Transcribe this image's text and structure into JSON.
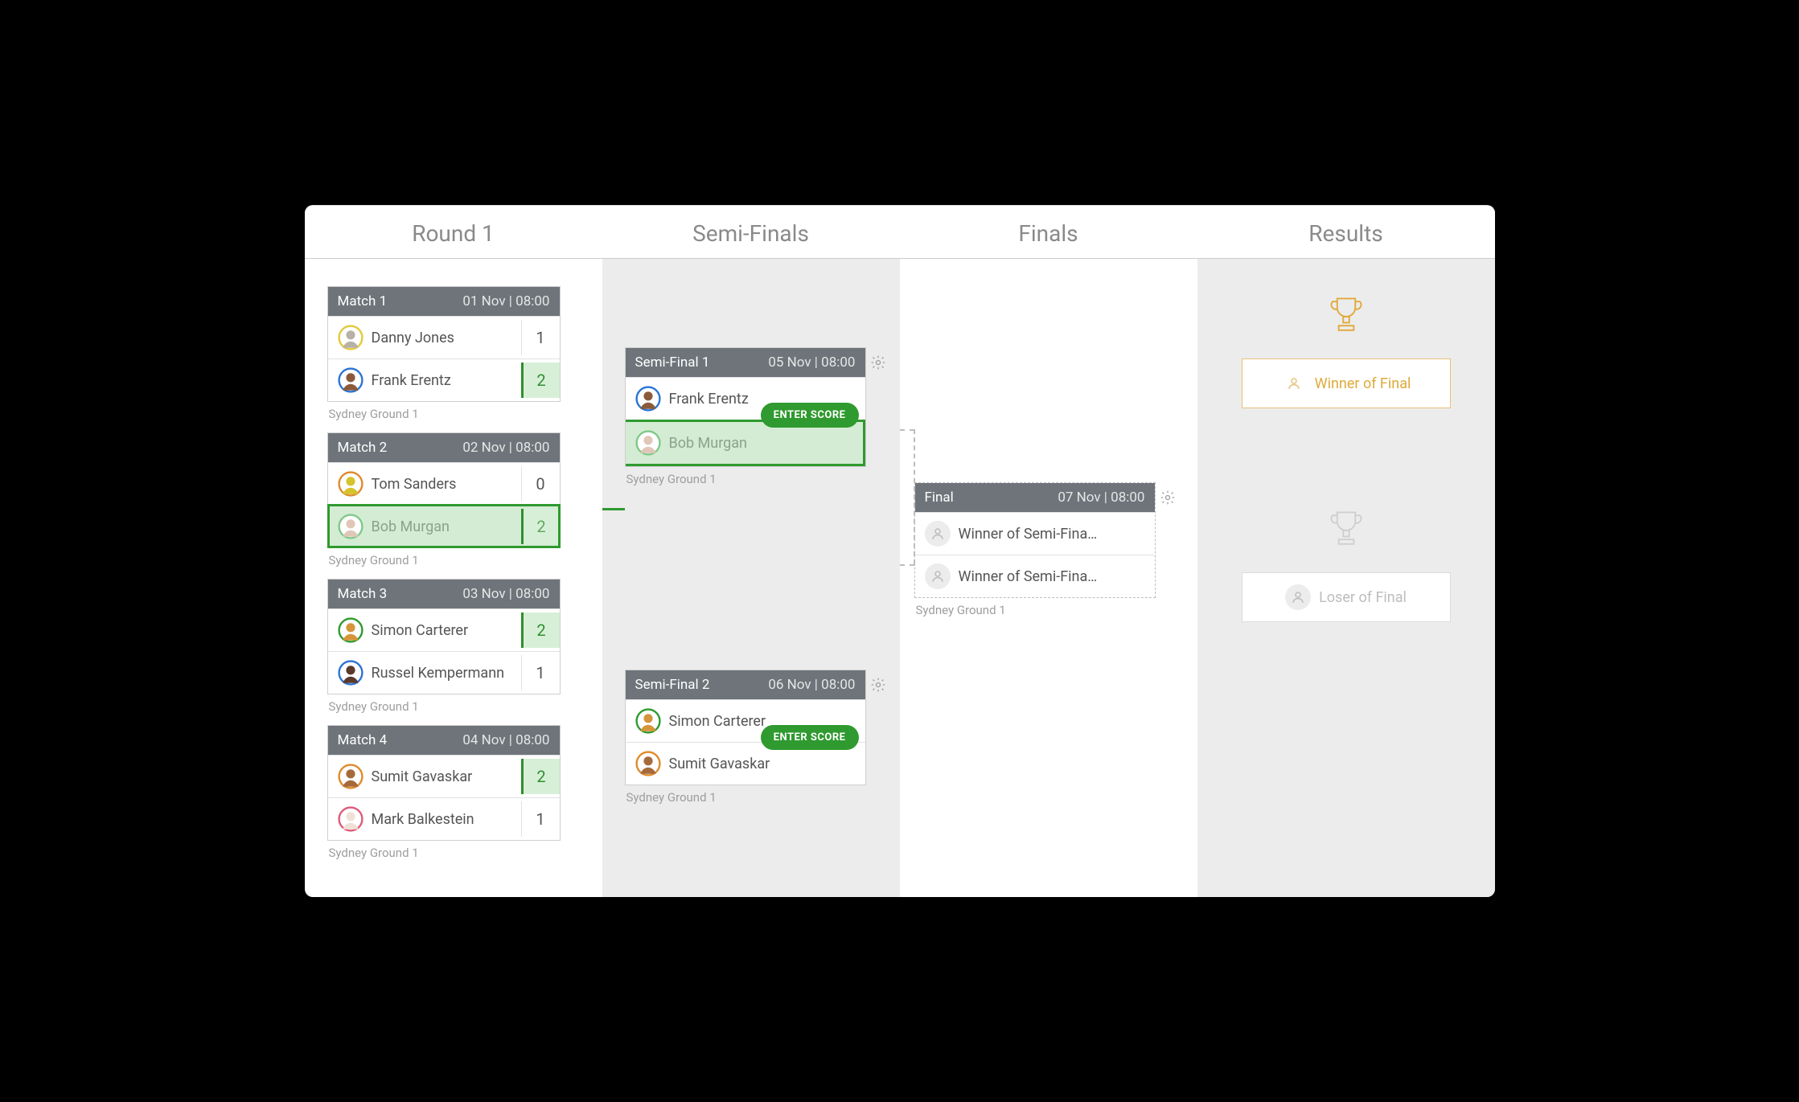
{
  "columns": {
    "round1": "Round 1",
    "semis": "Semi-Finals",
    "finals": "Finals",
    "results": "Results"
  },
  "venue": "Sydney Ground 1",
  "round1": [
    {
      "title": "Match 1",
      "date": "01 Nov | 08:00",
      "p": [
        {
          "name": "Danny Jones",
          "score": "1",
          "ring": "#e3c93a",
          "face": "#b8b1a8"
        },
        {
          "name": "Frank Erentz",
          "score": "2",
          "ring": "#2b74d6",
          "face": "#8a5a3a",
          "winner": true
        }
      ]
    },
    {
      "title": "Match 2",
      "date": "02 Nov | 08:00",
      "p": [
        {
          "name": "Tom Sanders",
          "score": "0",
          "ring": "#e08a2b",
          "face": "#d6c22b"
        },
        {
          "name": "Bob Murgan",
          "score": "2",
          "ring": "#7fc98a",
          "face": "#e0c7b8",
          "winner": true,
          "hilite": true
        }
      ]
    },
    {
      "title": "Match 3",
      "date": "03 Nov | 08:00",
      "p": [
        {
          "name": "Simon Carterer",
          "score": "2",
          "ring": "#2f9a2f",
          "face": "#d6953a",
          "winner": true
        },
        {
          "name": "Russel Kempermann",
          "score": "1",
          "ring": "#2b74d6",
          "face": "#5a3a2a"
        }
      ]
    },
    {
      "title": "Match 4",
      "date": "04 Nov | 08:00",
      "p": [
        {
          "name": "Sumit Gavaskar",
          "score": "2",
          "ring": "#e08a2b",
          "face": "#a66a3a",
          "winner": true
        },
        {
          "name": "Mark Balkestein",
          "score": "1",
          "ring": "#e05a7a",
          "face": "#f0e0d6"
        }
      ]
    }
  ],
  "semis": [
    {
      "title": "Semi-Final 1",
      "date": "05 Nov | 08:00",
      "enter_score": "ENTER SCORE",
      "p": [
        {
          "name": "Frank Erentz",
          "ring": "#2b74d6",
          "face": "#8a5a3a"
        },
        {
          "name": "Bob Murgan",
          "ring": "#7fc98a",
          "face": "#e0c7b8",
          "hilite": true
        }
      ]
    },
    {
      "title": "Semi-Final 2",
      "date": "06 Nov | 08:00",
      "enter_score": "ENTER SCORE",
      "p": [
        {
          "name": "Simon Carterer",
          "ring": "#2f9a2f",
          "face": "#d6953a"
        },
        {
          "name": "Sumit Gavaskar",
          "ring": "#e08a2b",
          "face": "#a66a3a"
        }
      ]
    }
  ],
  "final": {
    "title": "Final",
    "date": "07 Nov | 08:00",
    "p": [
      {
        "name": "Winner of Semi-Fina…"
      },
      {
        "name": "Winner of Semi-Fina…"
      }
    ]
  },
  "results": {
    "winner_label": "Winner of Final",
    "loser_label": "Loser of Final"
  }
}
